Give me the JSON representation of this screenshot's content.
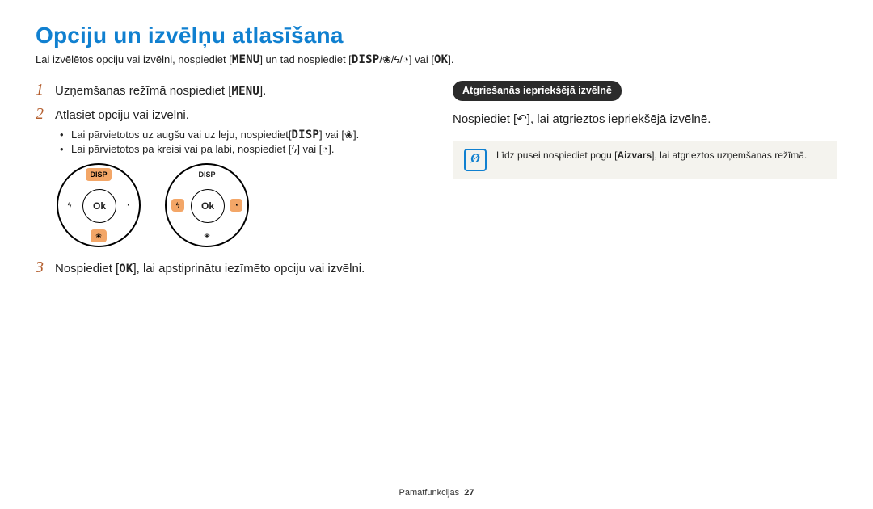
{
  "labels": {
    "MENU": "MENU",
    "DISP": "DISP",
    "OK": "OK"
  },
  "icons": {
    "flower": "❀",
    "flash": "ϟ",
    "timer": "◔",
    "back": "↶",
    "info": "Ø"
  },
  "title": "Opciju un izvēlņu atlasīšana",
  "intro": {
    "t1": "Lai izvēlētos opciju vai izvēlni, nospiediet [",
    "t2": "] un tad nospiediet [",
    "t3": "] vai [",
    "t4": "]."
  },
  "left": {
    "s1_num": "1",
    "s1_a": "Uzņemšanas režīmā nospiediet [",
    "s1_b": "].",
    "s2_num": "2",
    "s2_text": "Atlasiet opciju vai izvēlni.",
    "b1_a": "Lai pārvietotos uz augšu vai uz leju, nospiediet[",
    "b1_b": "] vai [",
    "b1_c": "].",
    "b2_a": "Lai pārvietotos pa kreisi vai pa labi, nospiediet [",
    "b2_b": "] vai [",
    "b2_c": "].",
    "dial_ok": "Ok",
    "dial_disp": "DISP",
    "s3_num": "3",
    "s3_a": "Nospiediet [",
    "s3_b": "], lai apstiprinātu iezīmēto opciju vai izvēlni."
  },
  "right": {
    "pill": "Atgriešanās iepriekšējā izvēlnē",
    "line_a": "Nospiediet [",
    "line_b": "], lai atgrieztos iepriekšējā izvēlnē.",
    "note_a": "Līdz pusei nospiediet pogu [",
    "note_bold": "Aizvars",
    "note_b": "], lai atgrieztos uzņemšanas režīmā."
  },
  "footer": {
    "label": "Pamatfunkcijas",
    "page": "27"
  }
}
